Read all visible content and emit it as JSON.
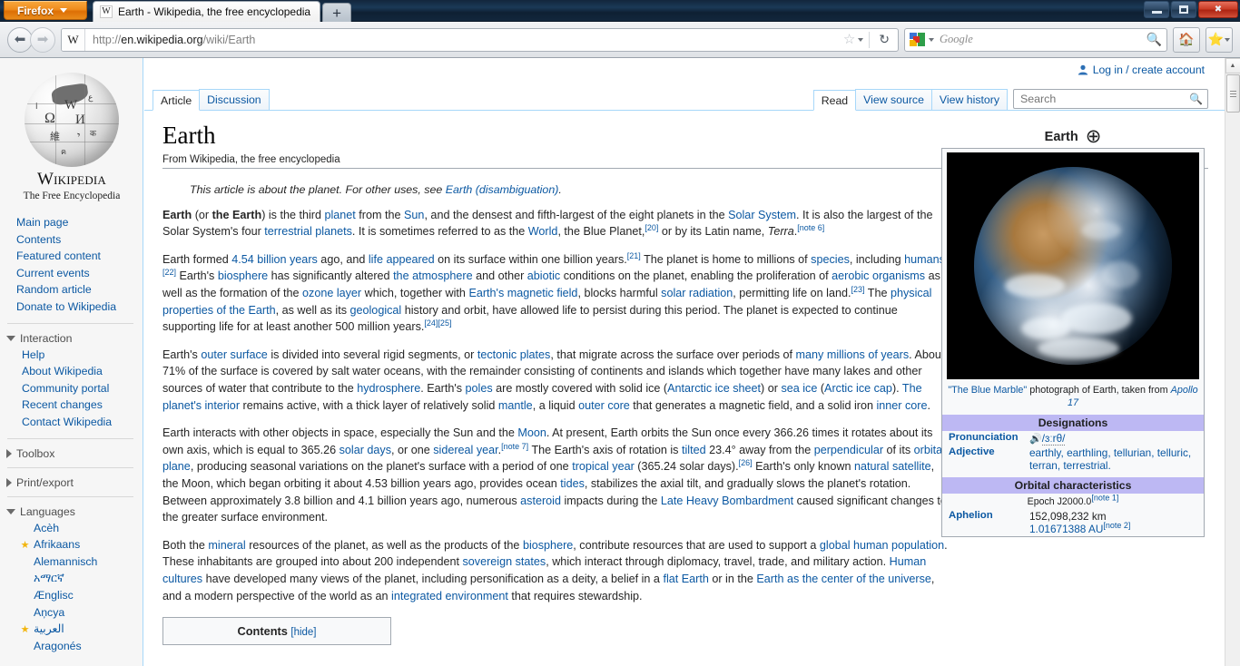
{
  "browser": {
    "firefox_button": "Firefox",
    "tab_title": "Earth - Wikipedia, the free encyclopedia",
    "tab_favicon_letter": "W",
    "new_tab_label": "+",
    "url_identity_letter": "W",
    "url_scheme": "http://",
    "url_host": "en.wikipedia.org",
    "url_path": "/wiki/Earth",
    "search_engine": "Google",
    "search_placeholder": "Google",
    "window_minimize": "–",
    "window_maximize": "❐",
    "window_close": "✕"
  },
  "sidebar": {
    "logo_wordmark": "Wikipedia",
    "logo_tagline": "The Free Encyclopedia",
    "nav": [
      "Main page",
      "Contents",
      "Featured content",
      "Current events",
      "Random article",
      "Donate to Wikipedia"
    ],
    "portals": [
      {
        "heading": "Interaction",
        "expanded": true,
        "items": [
          "Help",
          "About Wikipedia",
          "Community portal",
          "Recent changes",
          "Contact Wikipedia"
        ]
      },
      {
        "heading": "Toolbox",
        "expanded": false,
        "items": []
      },
      {
        "heading": "Print/export",
        "expanded": false,
        "items": []
      }
    ],
    "languages_heading": "Languages",
    "languages": [
      {
        "name": "Acèh",
        "featured": false,
        "rtl": false
      },
      {
        "name": "Afrikaans",
        "featured": true,
        "rtl": false
      },
      {
        "name": "Alemannisch",
        "featured": false,
        "rtl": false
      },
      {
        "name": "አማርኛ",
        "featured": false,
        "rtl": false
      },
      {
        "name": "Ænglisc",
        "featured": false,
        "rtl": false
      },
      {
        "name": "Aņcya",
        "featured": false,
        "rtl": false
      },
      {
        "name": "العربية",
        "featured": true,
        "rtl": true
      },
      {
        "name": "Aragonés",
        "featured": false,
        "rtl": false
      }
    ]
  },
  "userbar": {
    "login_label": "Log in / create account",
    "user_icon": "person-icon"
  },
  "namespace_tabs": [
    {
      "label": "Article",
      "selected": true
    },
    {
      "label": "Discussion",
      "selected": false
    }
  ],
  "action_tabs": [
    {
      "label": "Read",
      "selected": true
    },
    {
      "label": "View source",
      "selected": false
    },
    {
      "label": "View history",
      "selected": false
    }
  ],
  "search": {
    "value": "",
    "placeholder": "Search",
    "icon": "magnifier-icon"
  },
  "article": {
    "title": "Earth",
    "sub_title": "From Wikipedia, the free encyclopedia",
    "protected_icon": "lock-icon",
    "featured_icon": "star-icon",
    "hatnote_pre": "This article is about the planet. For other uses, see ",
    "hatnote_link": "Earth (disambiguation)",
    "hatnote_post": ".",
    "toc_title": "Contents",
    "toc_toggle": "[hide]"
  },
  "infobox": {
    "title": "Earth",
    "symbol": "⊕",
    "image_alt": "The Blue Marble photograph of Earth",
    "caption_quote": "\"The Blue Marble\"",
    "caption_rest": " photograph of Earth, taken from ",
    "caption_mission": "Apollo 17",
    "sections": [
      {
        "heading": "Designations",
        "subheading": "",
        "rows": [
          {
            "label": "Pronunciation",
            "value": "/ɜːrθ/",
            "icon": "speaker-icon"
          },
          {
            "label": "Adjective",
            "value": "earthly, earthling, tellurian, telluric, terran, terrestrial."
          }
        ]
      },
      {
        "heading": "Orbital characteristics",
        "subheading": "Epoch J2000.0",
        "subheading_note": "[note 1]",
        "rows": [
          {
            "label": "Aphelion",
            "value": "152,098,232 km",
            "value2": "1.01671388 AU",
            "value2_note": "[note 2]"
          }
        ]
      }
    ]
  },
  "scrollbar": {
    "up_arrow": "▲",
    "thumb": "scroll-thumb"
  }
}
